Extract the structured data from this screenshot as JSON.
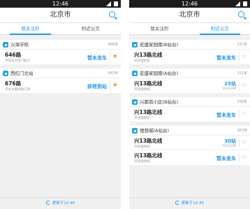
{
  "left": {
    "time": "12:46",
    "title": "北京市",
    "tabs": [
      "我关注的",
      "附近公交"
    ],
    "refresh": "更新于12:46",
    "stations": [
      {
        "name": "兴海学校",
        "dist": "466米",
        "lines": [
          {
            "name": "646路",
            "dir": "开往良乡西门路口",
            "status": "暂未发车",
            "star": "on"
          }
        ]
      },
      {
        "name": "西红门北站",
        "dist": "692米",
        "lines": [
          {
            "name": "676路",
            "dir": "开往长椿街路口西",
            "status": "即将到站",
            "star": "on"
          }
        ]
      }
    ]
  },
  "right": {
    "time": "12:46",
    "title": "北京市",
    "tabs": [
      "我关注的",
      "附近公交"
    ],
    "refresh": "更新于12:45",
    "stations": [
      {
        "name": "宏盛家园南(B站台)",
        "dist": "237米",
        "lines": [
          {
            "name": "兴13路北线",
            "dir": "开往理想城",
            "status": "暂未发车",
            "star": "off"
          }
        ]
      },
      {
        "name": "宏盛家园南(A站台)",
        "dist": "311米",
        "lines": [
          {
            "name": "兴13路北线",
            "dir": "开往理想城",
            "stops": "25站",
            "eta": "约43分钟",
            "star": "off"
          }
        ]
      },
      {
        "name": "兴都苑小区(B站台)",
        "dist": "338米",
        "lines": [
          {
            "name": "兴13路北线",
            "dir": "开往理想城",
            "status": "暂未发车",
            "star": "off"
          }
        ]
      },
      {
        "name": "理想城(A站台)",
        "dist": "383米",
        "lines": [
          {
            "name": "兴13路北线",
            "dir": "开往理想城",
            "stops": "30站",
            "eta": "约52分钟",
            "star": "off"
          },
          {
            "name": "兴13路北线",
            "dir": "开往理想城",
            "status": "暂未发车",
            "star": "off"
          }
        ]
      }
    ]
  }
}
